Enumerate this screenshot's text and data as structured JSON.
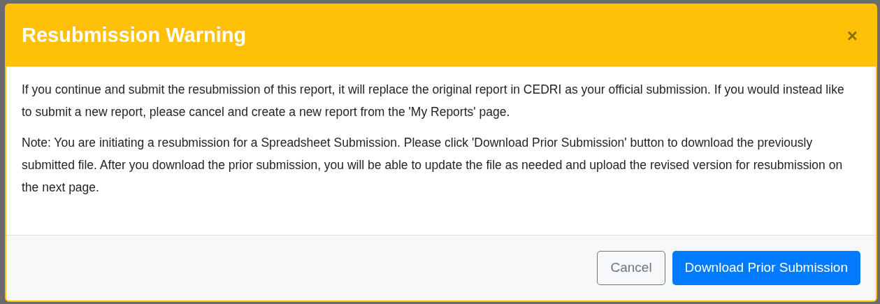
{
  "modal": {
    "title": "Resubmission Warning",
    "close": "×",
    "paragraphs": [
      "If you continue and submit the resubmission of this report, it will replace the original report in CEDRI as your official submission. If you would instead like to submit a new report, please cancel and create a new report from the 'My Reports' page.",
      "Note: You are initiating a resubmission for a Spreadsheet Submission. Please click 'Download Prior Submission' button to download the previously submitted file. After you download the prior submission, you will be able to update the file as needed and upload the revised version for resubmission on the next page."
    ],
    "buttons": [
      {
        "label": "Cancel",
        "kind": "secondary"
      },
      {
        "label": "Download Prior Submission",
        "kind": "primary"
      }
    ]
  }
}
